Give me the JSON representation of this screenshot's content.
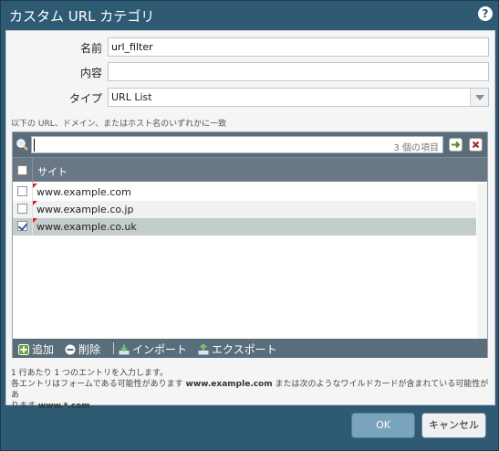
{
  "window": {
    "title": "カスタム URL カテゴリ",
    "help_icon": "help-icon",
    "help_label": "?"
  },
  "form": {
    "name_label": "名前",
    "name_value": "url_filter",
    "description_label": "内容",
    "description_value": "",
    "type_label": "タイプ",
    "type_value": "URL List"
  },
  "hint": "以下の URL、ドメイン、またはホスト名のいずれかに一致",
  "grid": {
    "search_value": "",
    "item_count": "3 個の項目",
    "header_site": "サイト",
    "rows": [
      {
        "text": "www.example.com",
        "checked": false
      },
      {
        "text": "www.example.co.jp",
        "checked": false
      },
      {
        "text": "www.example.co.uk",
        "checked": true
      }
    ]
  },
  "footer": {
    "add_label": "追加",
    "delete_label": "削除",
    "import_label": "インポート",
    "export_label": "エクスポート"
  },
  "notes": {
    "line1": "1 行あたり 1 つのエントリを入力します。",
    "line2_pre": "各エントリはフォームである可能性があります ",
    "line2_bold": "www.example.com",
    "line2_post": " または次のようなワイルドカードが含まれている可能性があ",
    "line3_pre": "ります ",
    "line3_bold": "www.*.com",
    "line3_post": "."
  },
  "buttons": {
    "ok": "OK",
    "cancel": "キャンセル"
  },
  "colors": {
    "frame": "#2f5a74",
    "toolbar": "#5a6d7b",
    "selected_row": "#c3cdcc"
  }
}
